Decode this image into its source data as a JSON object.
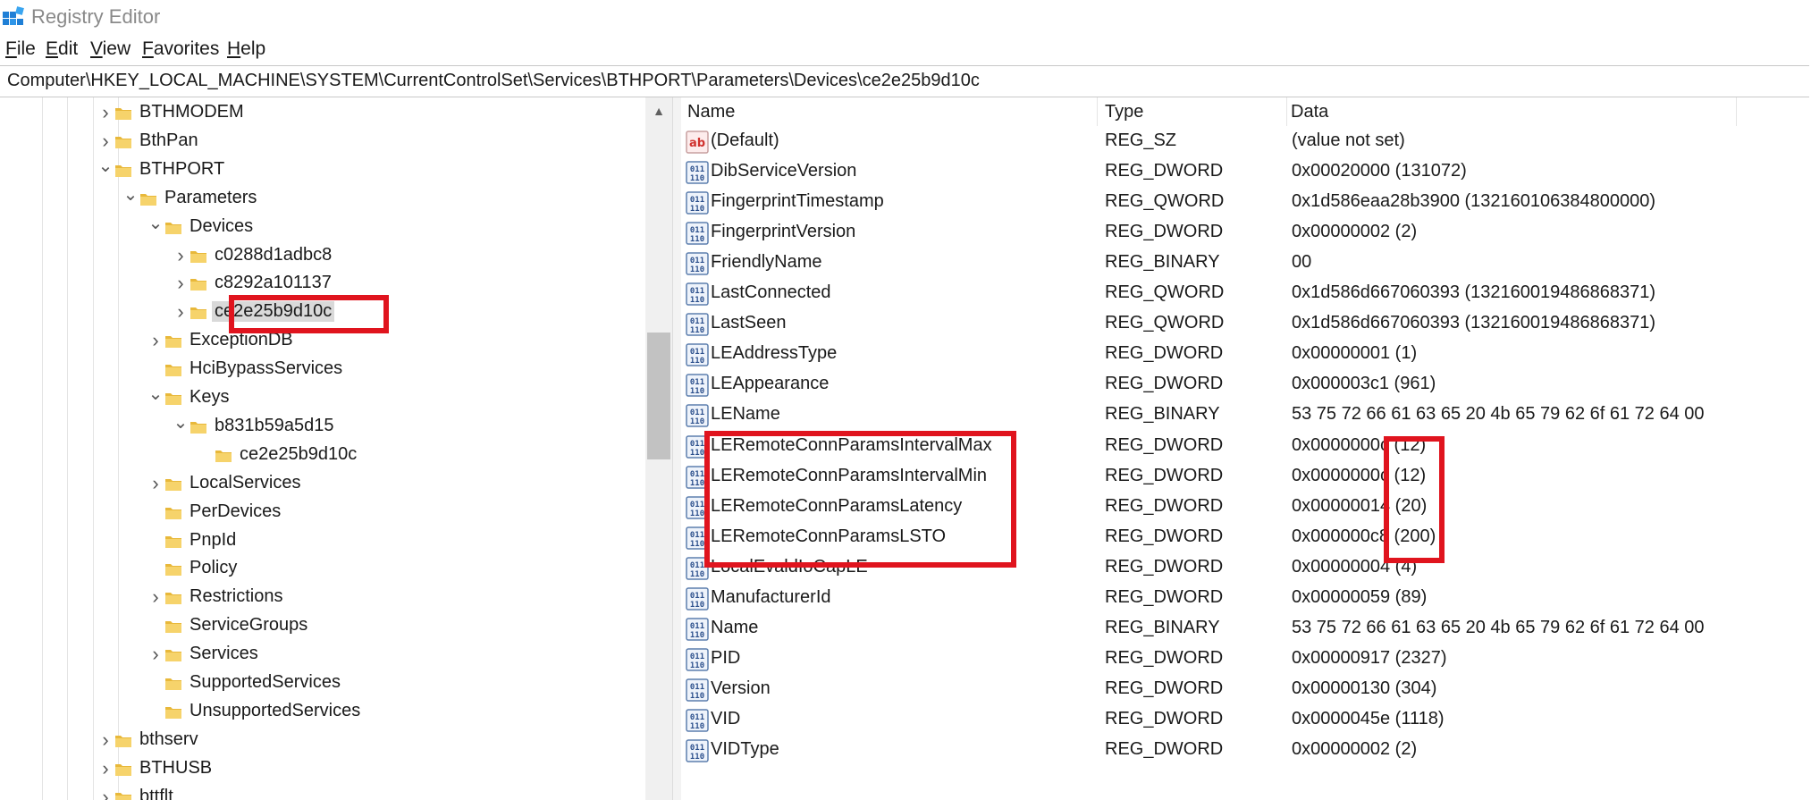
{
  "window": {
    "title": "Registry Editor",
    "accent_color": "#e0141e"
  },
  "menu": [
    "File",
    "Edit",
    "View",
    "Favorites",
    "Help"
  ],
  "address": "Computer\\HKEY_LOCAL_MACHINE\\SYSTEM\\CurrentControlSet\\Services\\BTHPORT\\Parameters\\Devices\\ce2e25b9d10c",
  "tree": [
    {
      "label": "BTHMODEM",
      "expander": "collapsed"
    },
    {
      "label": "BthPan",
      "expander": "collapsed"
    },
    {
      "label": "BTHPORT",
      "expander": "expanded"
    },
    {
      "label": "Parameters",
      "expander": "expanded"
    },
    {
      "label": "Devices",
      "expander": "expanded"
    },
    {
      "label": "c0288d1adbc8",
      "expander": "collapsed"
    },
    {
      "label": "c8292a101137",
      "expander": "collapsed"
    },
    {
      "label": "ce2e25b9d10c",
      "expander": "collapsed",
      "selected": true
    },
    {
      "label": "ExceptionDB",
      "expander": "collapsed"
    },
    {
      "label": "HciBypassServices",
      "expander": "none"
    },
    {
      "label": "Keys",
      "expander": "expanded"
    },
    {
      "label": "b831b59a5d15",
      "expander": "expanded"
    },
    {
      "label": "ce2e25b9d10c",
      "expander": "none"
    },
    {
      "label": "LocalServices",
      "expander": "collapsed"
    },
    {
      "label": "PerDevices",
      "expander": "none"
    },
    {
      "label": "PnpId",
      "expander": "none"
    },
    {
      "label": "Policy",
      "expander": "none"
    },
    {
      "label": "Restrictions",
      "expander": "collapsed"
    },
    {
      "label": "ServiceGroups",
      "expander": "none"
    },
    {
      "label": "Services",
      "expander": "collapsed"
    },
    {
      "label": "SupportedServices",
      "expander": "none"
    },
    {
      "label": "UnsupportedServices",
      "expander": "none"
    },
    {
      "label": "bthserv",
      "expander": "collapsed"
    },
    {
      "label": "BTHUSB",
      "expander": "collapsed"
    },
    {
      "label": "bttflt",
      "expander": "collapsed"
    }
  ],
  "columns": {
    "name": "Name",
    "type": "Type",
    "data": "Data"
  },
  "values": [
    {
      "icon": "string-value-icon",
      "name": "(Default)",
      "type": "REG_SZ",
      "data": "(value not set)"
    },
    {
      "icon": "binary-value-icon",
      "name": "DibServiceVersion",
      "type": "REG_DWORD",
      "data": "0x00020000 (131072)"
    },
    {
      "icon": "binary-value-icon",
      "name": "FingerprintTimestamp",
      "type": "REG_QWORD",
      "data": "0x1d586eaa28b3900 (132160106384800000)"
    },
    {
      "icon": "binary-value-icon",
      "name": "FingerprintVersion",
      "type": "REG_DWORD",
      "data": "0x00000002 (2)"
    },
    {
      "icon": "binary-value-icon",
      "name": "FriendlyName",
      "type": "REG_BINARY",
      "data": "00"
    },
    {
      "icon": "binary-value-icon",
      "name": "LastConnected",
      "type": "REG_QWORD",
      "data": "0x1d586d667060393 (132160019486868371)"
    },
    {
      "icon": "binary-value-icon",
      "name": "LastSeen",
      "type": "REG_QWORD",
      "data": "0x1d586d667060393 (132160019486868371)"
    },
    {
      "icon": "binary-value-icon",
      "name": "LEAddressType",
      "type": "REG_DWORD",
      "data": "0x00000001 (1)"
    },
    {
      "icon": "binary-value-icon",
      "name": "LEAppearance",
      "type": "REG_DWORD",
      "data": "0x000003c1 (961)"
    },
    {
      "icon": "binary-value-icon",
      "name": "LEName",
      "type": "REG_BINARY",
      "data": "53 75 72 66 61 63 65 20 4b 65 79 62 6f 61 72 64 00"
    },
    {
      "icon": "binary-value-icon",
      "name": "LERemoteConnParamsIntervalMax",
      "type": "REG_DWORD",
      "data": "0x0000000c (12)"
    },
    {
      "icon": "binary-value-icon",
      "name": "LERemoteConnParamsIntervalMin",
      "type": "REG_DWORD",
      "data": "0x0000000c (12)"
    },
    {
      "icon": "binary-value-icon",
      "name": "LERemoteConnParamsLatency",
      "type": "REG_DWORD",
      "data": "0x00000014 (20)"
    },
    {
      "icon": "binary-value-icon",
      "name": "LERemoteConnParamsLSTO",
      "type": "REG_DWORD",
      "data": "0x000000c8 (200)"
    },
    {
      "icon": "binary-value-icon",
      "name": "LocalEvaldIoCapLE",
      "type": "REG_DWORD",
      "data": "0x00000004 (4)"
    },
    {
      "icon": "binary-value-icon",
      "name": "ManufacturerId",
      "type": "REG_DWORD",
      "data": "0x00000059 (89)"
    },
    {
      "icon": "binary-value-icon",
      "name": "Name",
      "type": "REG_BINARY",
      "data": "53 75 72 66 61 63 65 20 4b 65 79 62 6f 61 72 64 00"
    },
    {
      "icon": "binary-value-icon",
      "name": "PID",
      "type": "REG_DWORD",
      "data": "0x00000917 (2327)"
    },
    {
      "icon": "binary-value-icon",
      "name": "Version",
      "type": "REG_DWORD",
      "data": "0x00000130 (304)"
    },
    {
      "icon": "binary-value-icon",
      "name": "VID",
      "type": "REG_DWORD",
      "data": "0x0000045e (1118)"
    },
    {
      "icon": "binary-value-icon",
      "name": "VIDType",
      "type": "REG_DWORD",
      "data": "0x00000002 (2)"
    }
  ]
}
